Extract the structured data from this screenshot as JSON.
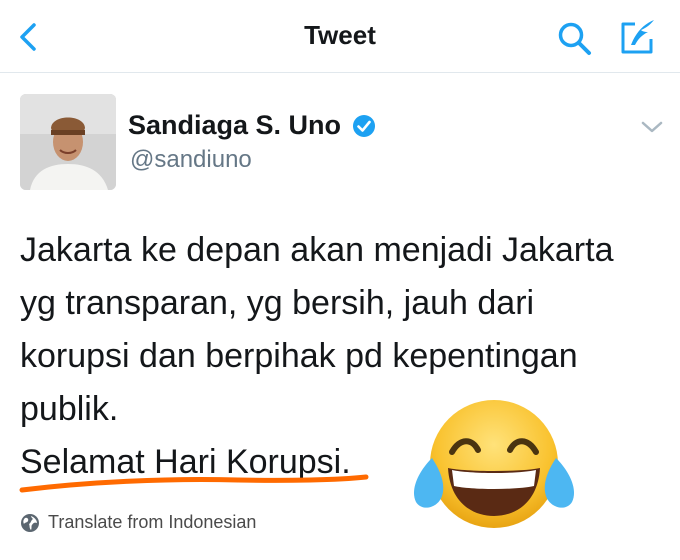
{
  "navbar": {
    "title": "Tweet",
    "back_icon": "chevron-left-icon",
    "search_icon": "search-icon",
    "compose_icon": "compose-icon",
    "accent_color": "#1da1f2"
  },
  "author": {
    "name": "Sandiaga S. Uno",
    "handle": "@sandiuno",
    "verified": true,
    "verified_icon": "verified-badge-icon"
  },
  "tweet": {
    "lines": [
      "Jakarta ke depan akan menjadi Jakarta",
      "yg transparan, yg bersih, jauh dari",
      "korupsi dan berpihak pd kepentingan",
      "publik."
    ],
    "highlight": "Selamat Hari Korupsi.",
    "highlight_color": "#ff6a00"
  },
  "translate": {
    "label": "Translate from Indonesian",
    "icon": "globe-icon"
  },
  "overlay": {
    "emoji": "face-with-tears-of-joy-emoji"
  }
}
